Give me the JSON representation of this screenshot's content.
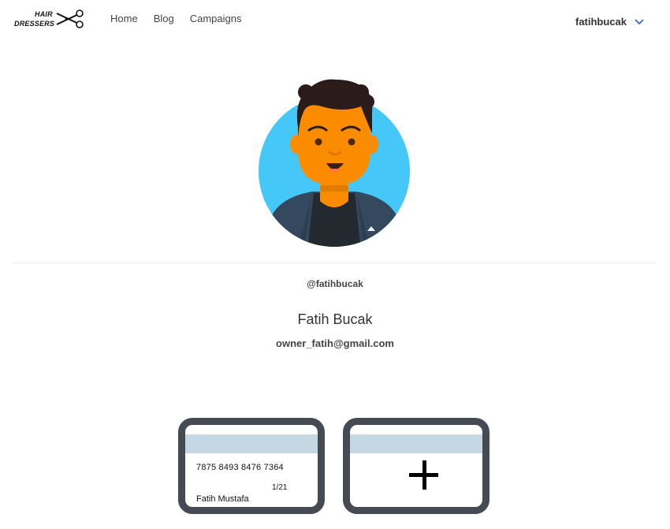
{
  "brand": {
    "line1": "HAIR",
    "line2": "DRESSERS",
    "icon": "scissors-icon"
  },
  "nav": {
    "items": [
      {
        "label": "Home"
      },
      {
        "label": "Blog"
      },
      {
        "label": "Campaigns"
      }
    ]
  },
  "user_menu": {
    "username": "fatihbucak",
    "icon": "chevron-down-icon"
  },
  "profile": {
    "avatar_icon": "user-avatar-icon",
    "handle": "@fatihbucak",
    "full_name": "Fatih Bucak",
    "email": "owner_fatih@gmail.com"
  },
  "cards": [
    {
      "number": "7875 8493 8476 7364",
      "expiry": "1/21",
      "holder": "Fatih Mustafa"
    }
  ],
  "add_card": {
    "icon": "plus-icon"
  },
  "colors": {
    "accent": "#2f6fd6",
    "avatar_bg": "#45c8f8",
    "card_border": "#454a53",
    "card_stripe": "#c5d7e3"
  }
}
